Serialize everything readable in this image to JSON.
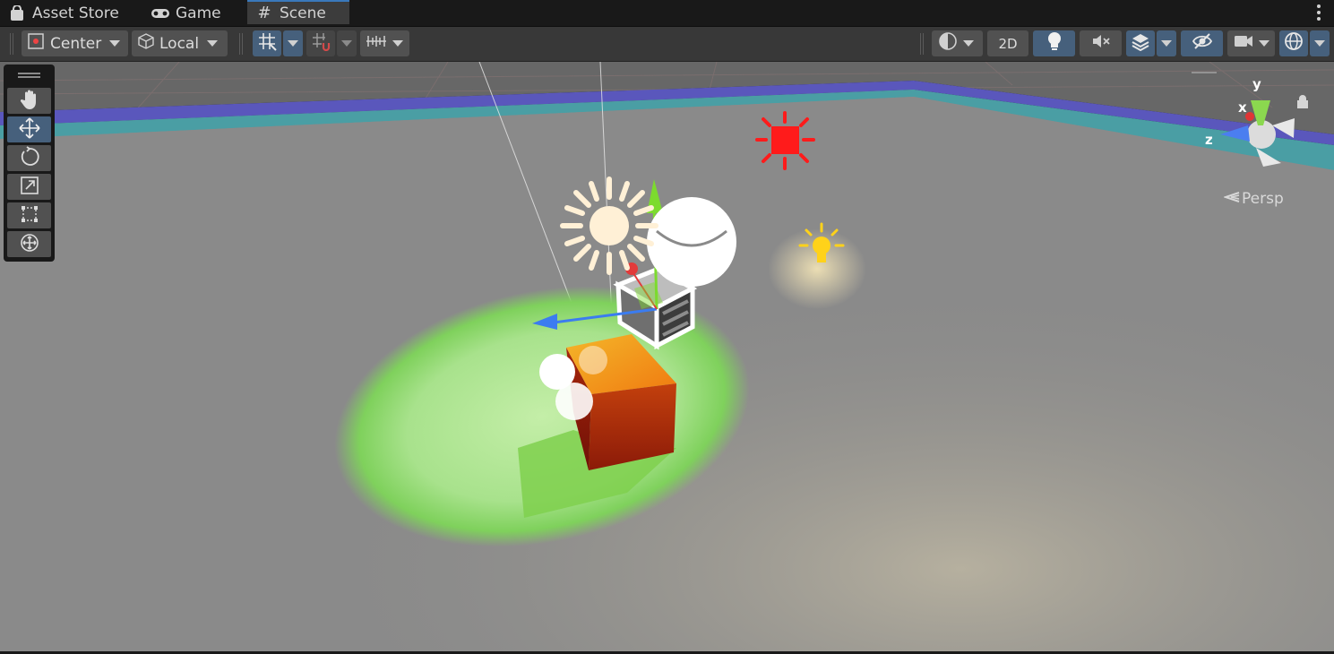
{
  "tabs": [
    {
      "label": "Asset Store",
      "icon": "bag-icon"
    },
    {
      "label": "Game",
      "icon": "gamepad-icon"
    },
    {
      "label": "Scene",
      "icon": "grid-hash-icon",
      "active": true
    }
  ],
  "toolbar": {
    "pivot_mode": "Center",
    "pivot_rotation": "Local",
    "mode_2d": "2D"
  },
  "tools": [
    "hand-icon",
    "move-icon",
    "rotate-icon",
    "scale-icon",
    "rect-icon",
    "transform-icon"
  ],
  "active_tool": "move-icon",
  "gizmo": {
    "axis_x": "x",
    "axis_y": "y",
    "axis_z": "z",
    "projection": "Persp"
  },
  "colors": {
    "accent": "#46607c",
    "active_tab_border": "#3a79bb",
    "toolbar": "#383838",
    "ground": "#8a8a8a"
  }
}
